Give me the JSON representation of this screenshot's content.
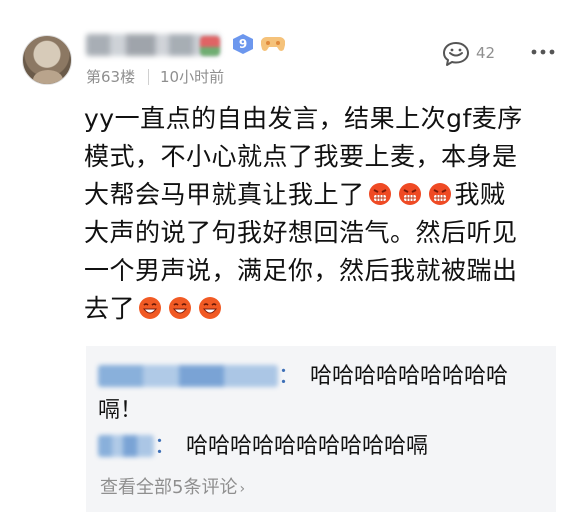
{
  "post": {
    "floor": "第63楼",
    "time": "10小时前",
    "level": "9",
    "comment_count": "42",
    "lines": [
      "yy一直点的自由发言，结果上次gf麦序",
      "模式，不小心就点了我要上麦，本身是",
      "大帮会马甲就真让我上了",
      "我贼",
      "大声的说了句我好想回浩气。然后听见",
      "一个男声说，满足你，然后我就被踹出",
      "去了"
    ]
  },
  "icons": {
    "game": "game-controller-icon",
    "comment": "comment-bubble-icon",
    "more": "more-dots-icon",
    "emoji_angry": "angry-face-emoji",
    "emoji_laugh": "laugh-face-emoji"
  },
  "replies": [
    {
      "text": "哈哈哈哈哈哈哈哈哈嗝！"
    },
    {
      "text": "哈哈哈哈哈哈哈哈哈哈嗝"
    }
  ],
  "view_all": "查看全部5条评论",
  "colors": {
    "reply_bg": "#f4f5f7",
    "badge": "#6c97ee",
    "reply_name": "#3d6fb6",
    "meta": "#8f8f8f"
  }
}
